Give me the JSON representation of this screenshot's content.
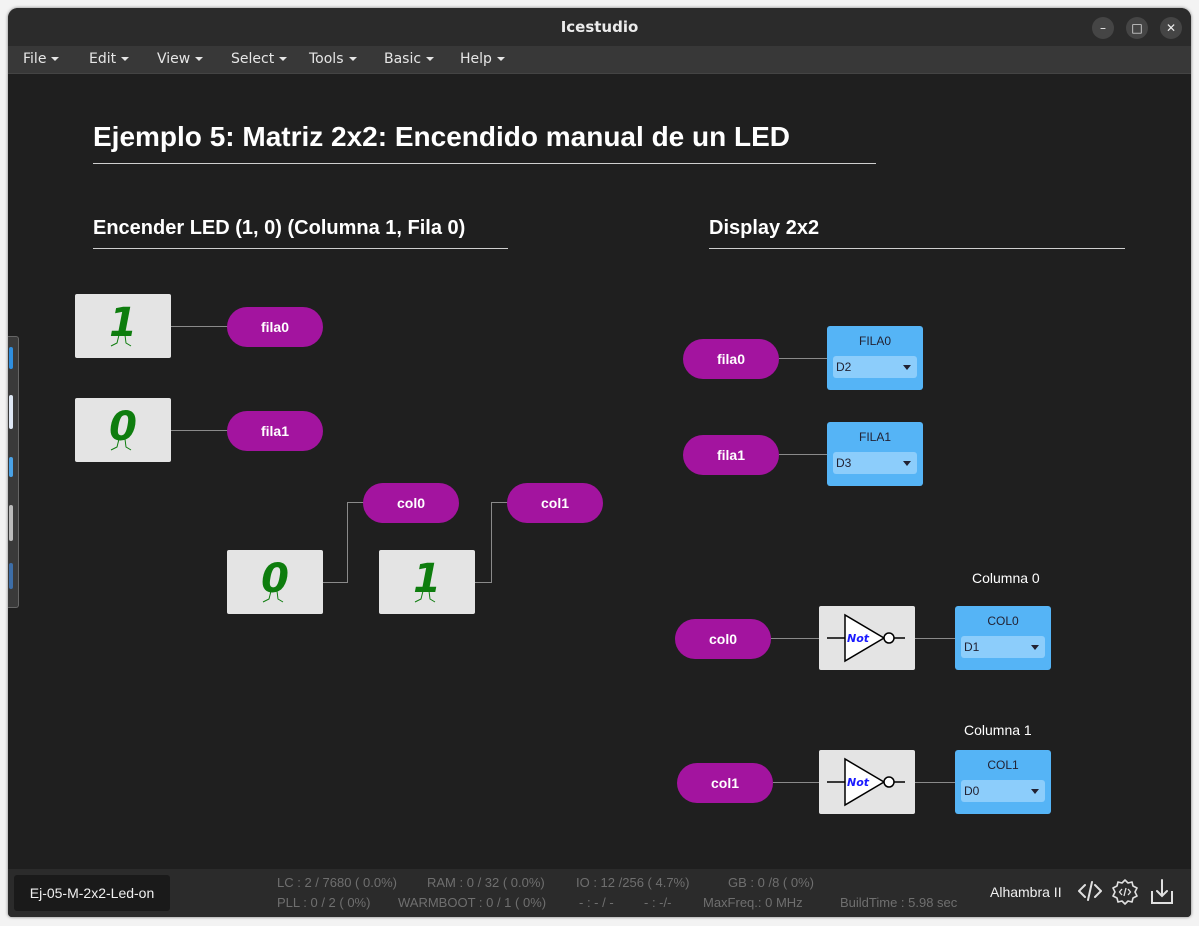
{
  "window": {
    "title": "Icestudio",
    "controls": [
      "–",
      "□",
      "✕"
    ]
  },
  "menu": [
    "File",
    "Edit",
    "View",
    "Select",
    "Tools",
    "Basic",
    "Help"
  ],
  "canvas": {
    "title": "Ejemplo 5: Matriz 2x2: Encendido manual de un LED",
    "section_left": "Encender LED (1, 0) (Columna 1, Fila 0)",
    "section_right": "Display 2x2",
    "left": {
      "const_fila0": "1",
      "const_fila1": "0",
      "const_col0": "0",
      "const_col1": "1",
      "label_fila0": "fila0",
      "label_fila1": "fila1",
      "label_col0": "col0",
      "label_col1": "col1"
    },
    "right": {
      "label_fila0": "fila0",
      "label_fila1": "fila1",
      "label_col0": "col0",
      "label_col1": "col1",
      "out_fila0": {
        "name": "FILA0",
        "pin": "D2"
      },
      "out_fila1": {
        "name": "FILA1",
        "pin": "D3"
      },
      "out_col0": {
        "name": "COL0",
        "pin": "D1"
      },
      "out_col1": {
        "name": "COL1",
        "pin": "D0"
      },
      "not_label": "Not",
      "comment_col0": "Columna 0",
      "comment_col1": "Columna 1"
    }
  },
  "status": {
    "project": "Ej-05-M-2x2-Led-on",
    "lc": "LC : 2 / 7680 ( 0.0%)",
    "ram": "RAM : 0 / 32 ( 0.0%)",
    "io": "IO :  12 /256  ( 4.7%)",
    "gb": "GB :  0 /8  ( 0%)",
    "pll": "PLL : 0 / 2 ( 0%)",
    "warmboot": "WARMBOOT : 0 / 1 ( 0%)",
    "extra1": "- : - / -",
    "extra2": "- :  -/-",
    "maxfreq": "MaxFreq.:  0 MHz",
    "buildtime": "BuildTime :  5.98 sec",
    "board": "Alhambra II"
  },
  "colors": {
    "label": "#a3149f",
    "io_block": "#55b4f6",
    "const_digit": "#0e7d0e",
    "not_text": "#1a1aff"
  }
}
